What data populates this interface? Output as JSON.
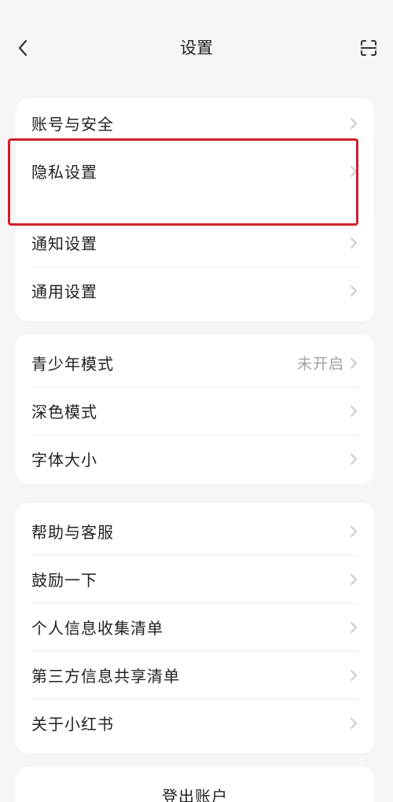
{
  "header": {
    "title": "设置",
    "back_icon": "chevron-left-icon",
    "scan_icon": "scan-icon"
  },
  "groups": [
    {
      "items": [
        {
          "label": "账号与安全",
          "value": ""
        },
        {
          "label": "隐私设置",
          "value": ""
        },
        {
          "label": "通知设置",
          "value": ""
        },
        {
          "label": "通用设置",
          "value": ""
        }
      ]
    },
    {
      "items": [
        {
          "label": "青少年模式",
          "value": "未开启"
        },
        {
          "label": "深色模式",
          "value": ""
        },
        {
          "label": "字体大小",
          "value": ""
        }
      ]
    },
    {
      "items": [
        {
          "label": "帮助与客服",
          "value": ""
        },
        {
          "label": "鼓励一下",
          "value": ""
        },
        {
          "label": "个人信息收集清单",
          "value": ""
        },
        {
          "label": "第三方信息共享清单",
          "value": ""
        },
        {
          "label": "关于小红书",
          "value": ""
        }
      ]
    }
  ],
  "logout": {
    "label": "登出账户"
  },
  "colors": {
    "background": "#f5f5f7",
    "card": "#ffffff",
    "highlight_border": "#d0202a",
    "muted_text": "#a3a3a3"
  }
}
